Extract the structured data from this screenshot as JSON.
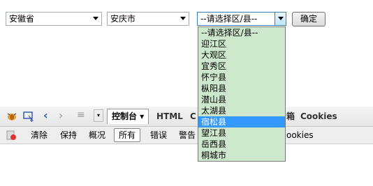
{
  "selects": {
    "province": "安徽省",
    "city": "安庆市",
    "district": "--请选择区/县--"
  },
  "confirm_label": "确定",
  "dropdown": {
    "options": [
      "--请选择区/县--",
      "迎江区",
      "大观区",
      "宜秀区",
      "怀宁县",
      "枞阳县",
      "潜山县",
      "太湖县",
      "宿松县",
      "望江县",
      "岳西县",
      "桐城市"
    ],
    "selected_index": 8
  },
  "firebug": {
    "tabs": {
      "console": "控制台 ▾",
      "html": "HTML",
      "css_partial": "C",
      "dom_partial": "箱",
      "cookies": "Cookies"
    },
    "subbar": {
      "clear": "清除",
      "persist": "保持",
      "profile": "概况",
      "all": "所有",
      "errors": "错误",
      "warnings": "警告",
      "cookies": "ookies"
    }
  }
}
